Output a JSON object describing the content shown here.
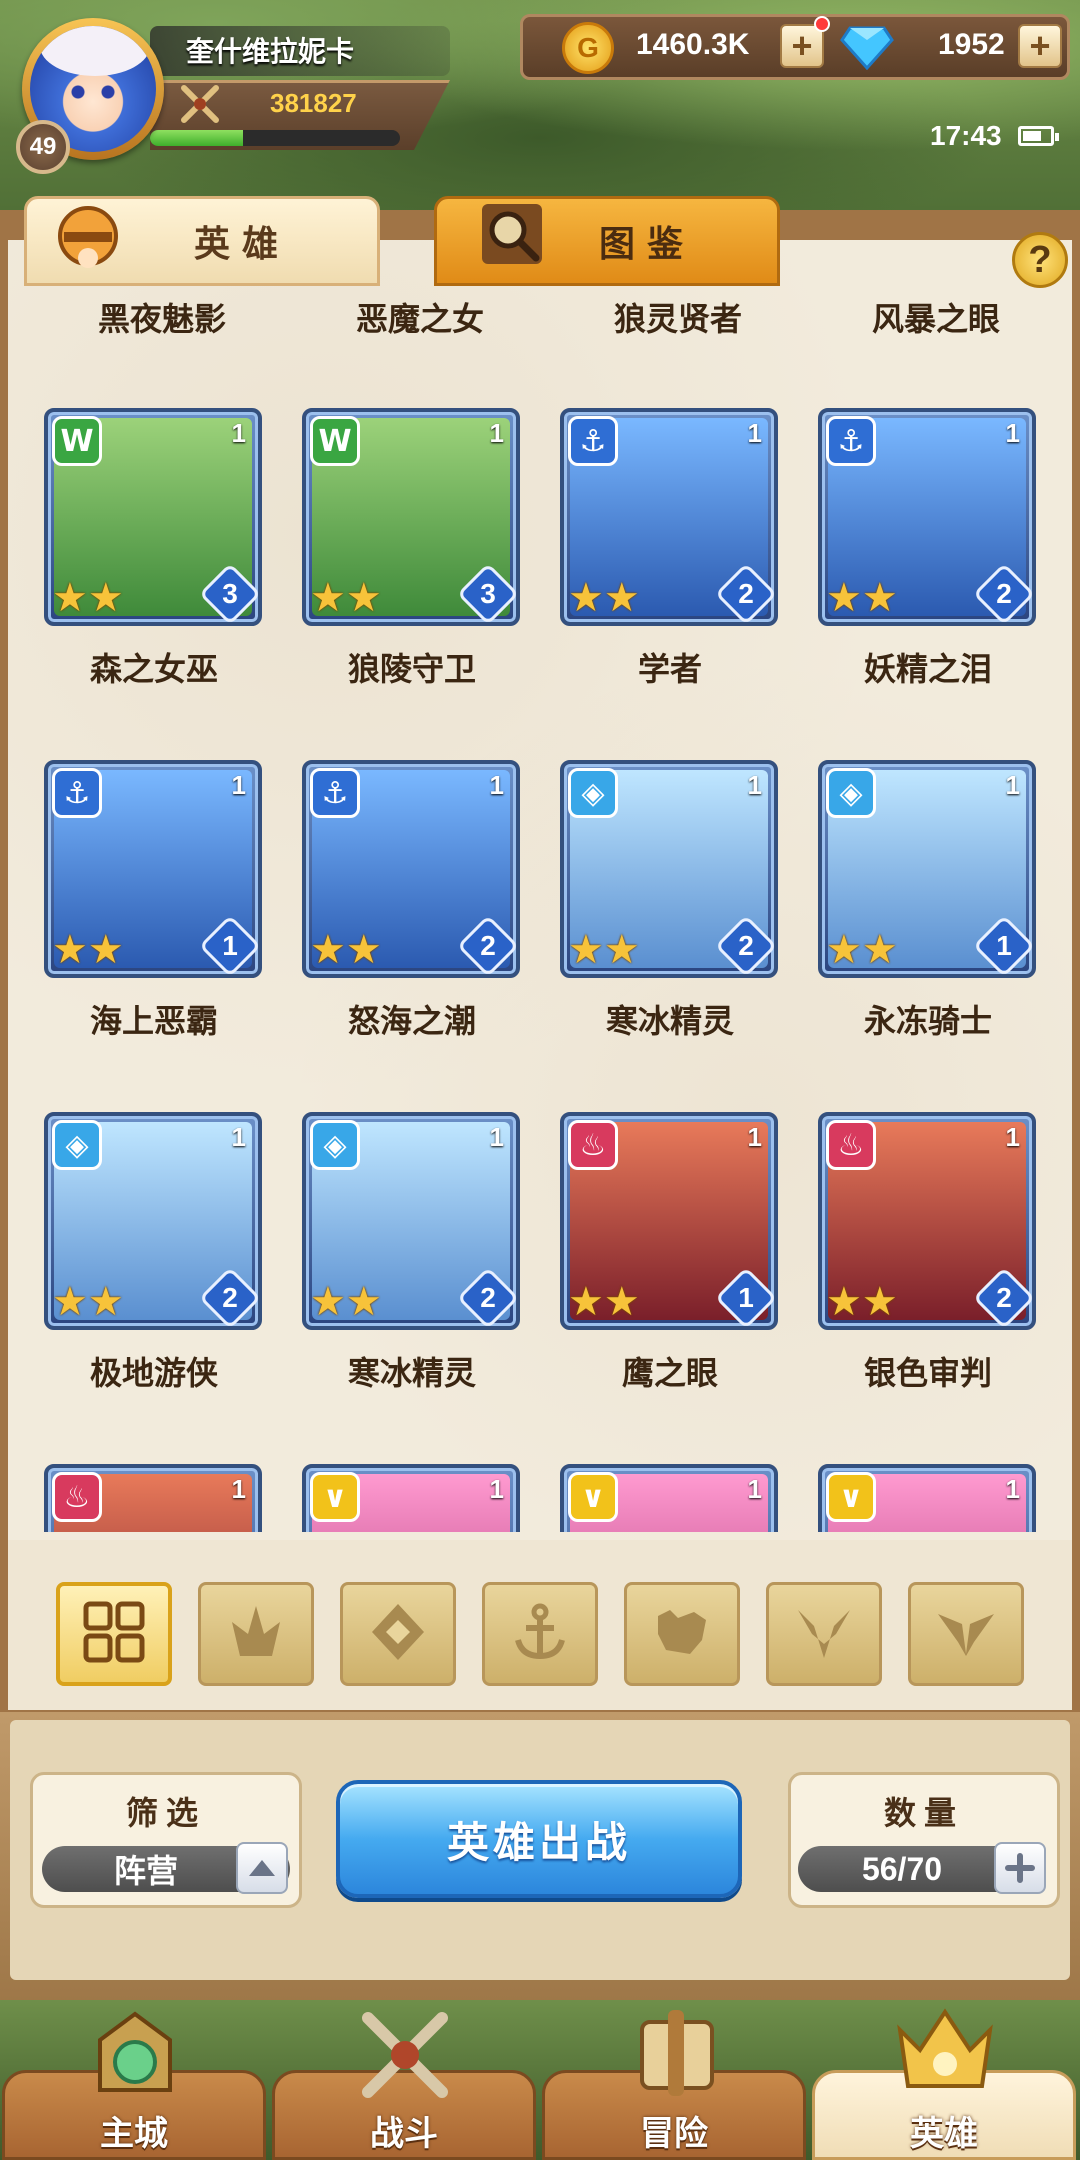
{
  "player": {
    "name": "奎什维拉妮卡",
    "level": "49",
    "power": "381827",
    "exp_fraction": 0.37
  },
  "currency": {
    "gold": "1460.3K",
    "gems": "1952",
    "plus": "+"
  },
  "status_bar": {
    "time": "17:43"
  },
  "tabs": {
    "heroes": "英雄",
    "codex": "图鉴"
  },
  "help": "?",
  "top_row_names": [
    "黑夜魅影",
    "恶魔之女",
    "狼灵贤者",
    "风暴之眼"
  ],
  "heroes": [
    {
      "name": "森之女巫",
      "faction": "forest",
      "faction_icon": "wolf-emblem-icon",
      "level": "1",
      "stars": "★★",
      "star_level": "3"
    },
    {
      "name": "狼陵守卫",
      "faction": "forest",
      "faction_icon": "wolf-emblem-icon",
      "level": "1",
      "stars": "★★",
      "star_level": "3"
    },
    {
      "name": "学者",
      "faction": "sea",
      "faction_icon": "anchor-icon",
      "level": "1",
      "stars": "★★",
      "star_level": "2"
    },
    {
      "name": "妖精之泪",
      "faction": "sea",
      "faction_icon": "anchor-icon",
      "level": "1",
      "stars": "★★",
      "star_level": "2"
    },
    {
      "name": "海上恶霸",
      "faction": "sea",
      "faction_icon": "anchor-icon",
      "level": "1",
      "stars": "★★",
      "star_level": "1"
    },
    {
      "name": "怒海之潮",
      "faction": "sea",
      "faction_icon": "anchor-icon",
      "level": "1",
      "stars": "★★",
      "star_level": "2"
    },
    {
      "name": "寒冰精灵",
      "faction": "ice",
      "faction_icon": "ice-crystal-icon",
      "level": "1",
      "stars": "★★",
      "star_level": "2"
    },
    {
      "name": "永冻骑士",
      "faction": "ice",
      "faction_icon": "ice-crystal-icon",
      "level": "1",
      "stars": "★★",
      "star_level": "1"
    },
    {
      "name": "极地游侠",
      "faction": "ice",
      "faction_icon": "ice-crystal-icon",
      "level": "1",
      "stars": "★★",
      "star_level": "2"
    },
    {
      "name": "寒冰精灵",
      "faction": "ice",
      "faction_icon": "ice-crystal-icon",
      "level": "1",
      "stars": "★★",
      "star_level": "2"
    },
    {
      "name": "鹰之眼",
      "faction": "fire",
      "faction_icon": "flame-icon",
      "level": "1",
      "stars": "★★",
      "star_level": "1"
    },
    {
      "name": "银色审判",
      "faction": "fire",
      "faction_icon": "flame-icon",
      "level": "1",
      "stars": "★★",
      "star_level": "2"
    }
  ],
  "partial_row": [
    {
      "faction": "fire",
      "level": "1"
    },
    {
      "faction": "light",
      "level": "1"
    },
    {
      "faction": "light",
      "level": "1"
    },
    {
      "faction": "light",
      "level": "1"
    }
  ],
  "filters": [
    "all-grid-icon",
    "flame-icon",
    "ice-crystal-icon",
    "anchor-icon",
    "wolf-emblem-icon",
    "dark-horns-icon",
    "light-wings-icon"
  ],
  "filter_box": {
    "label": "筛选",
    "value": "阵营"
  },
  "deploy_button": "英雄出战",
  "count_box": {
    "label": "数量",
    "value": "56/70"
  },
  "nav": {
    "city": "主城",
    "battle": "战斗",
    "adventure": "冒险",
    "heroes": "英雄"
  },
  "colors": {
    "forest": "#3aa642",
    "sea": "#2f6ed4",
    "ice": "#38a7e8",
    "fire": "#d83a5e",
    "light": "#f2c21a",
    "deploy": "#45aaf0"
  }
}
